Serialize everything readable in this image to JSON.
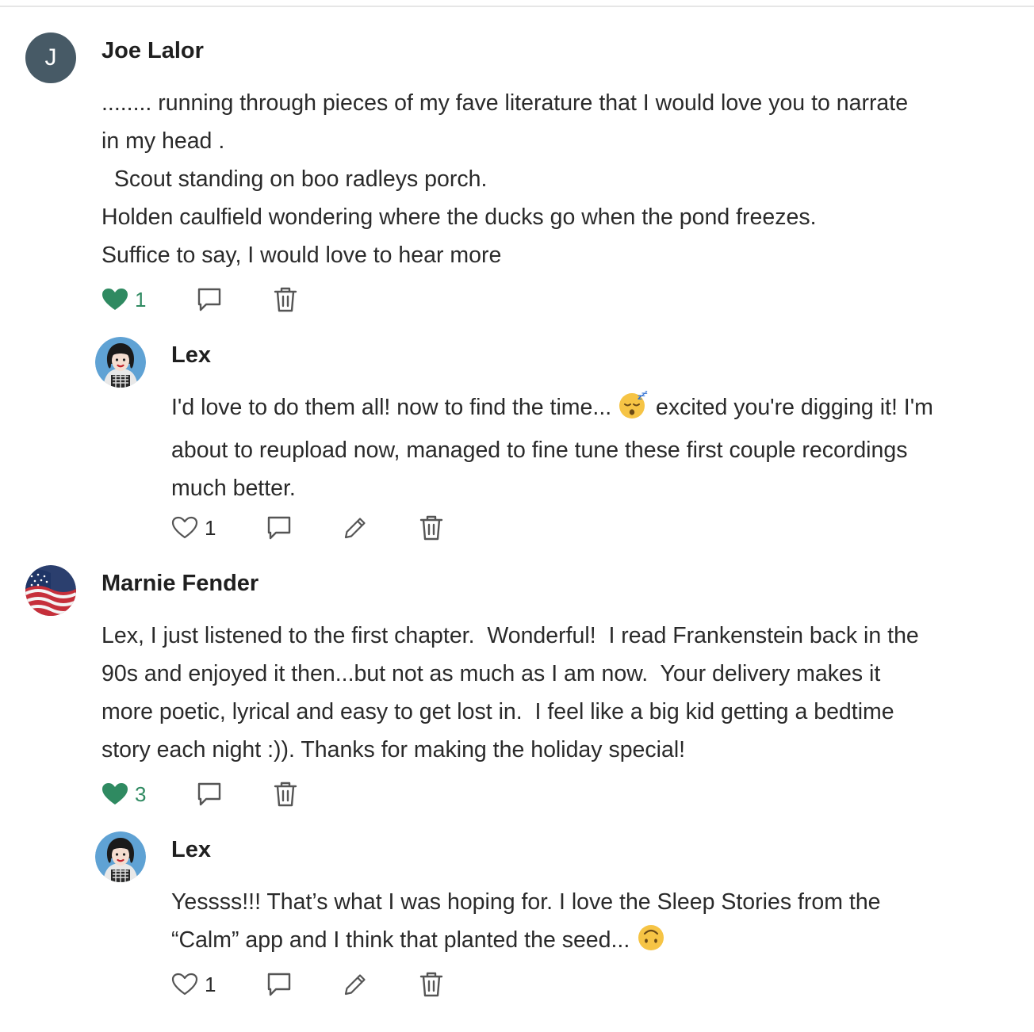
{
  "comments": [
    {
      "author": "Joe Lalor",
      "avatar_letter": "J",
      "lines": [
        "........ running through pieces of my fave literature that I would love you to narrate",
        "in my head .",
        "  Scout standing on boo radleys porch.",
        "Holden caulfield wondering where the ducks go when the pond freezes.",
        "Suffice to say, I would love to hear more"
      ],
      "likes": "1",
      "liked": true
    },
    {
      "author": "Lex",
      "lines": [
        "I'd love to do them all! now to find the time...",
        "excited you're digging it! I'm",
        "about to reupload now, managed to fine tune these first couple recordings",
        "much better."
      ],
      "emoji": "sleeping-face",
      "likes": "1",
      "liked": false
    },
    {
      "author": "Marnie Fender",
      "lines": [
        "Lex, I just listened to the first chapter.  Wonderful!  I read Frankenstein back in the",
        "90s and enjoyed it then...but not as much as I am now.  Your delivery makes it",
        "more poetic, lyrical and easy to get lost in.  I feel like a big kid getting a bedtime",
        "story each night :)). Thanks for making the holiday special!"
      ],
      "likes": "3",
      "liked": true
    },
    {
      "author": "Lex",
      "lines": [
        "Yessss!!! That’s what I was hoping for. I love the Sleep Stories from the",
        "“Calm” app and I think that planted the seed..."
      ],
      "emoji": "upside-down-face",
      "likes": "1",
      "liked": false
    }
  ],
  "colors": {
    "liked": "#2f8a61",
    "icon": "#555555",
    "text": "#2a2a2a",
    "avatar_bg": "#475a66"
  }
}
